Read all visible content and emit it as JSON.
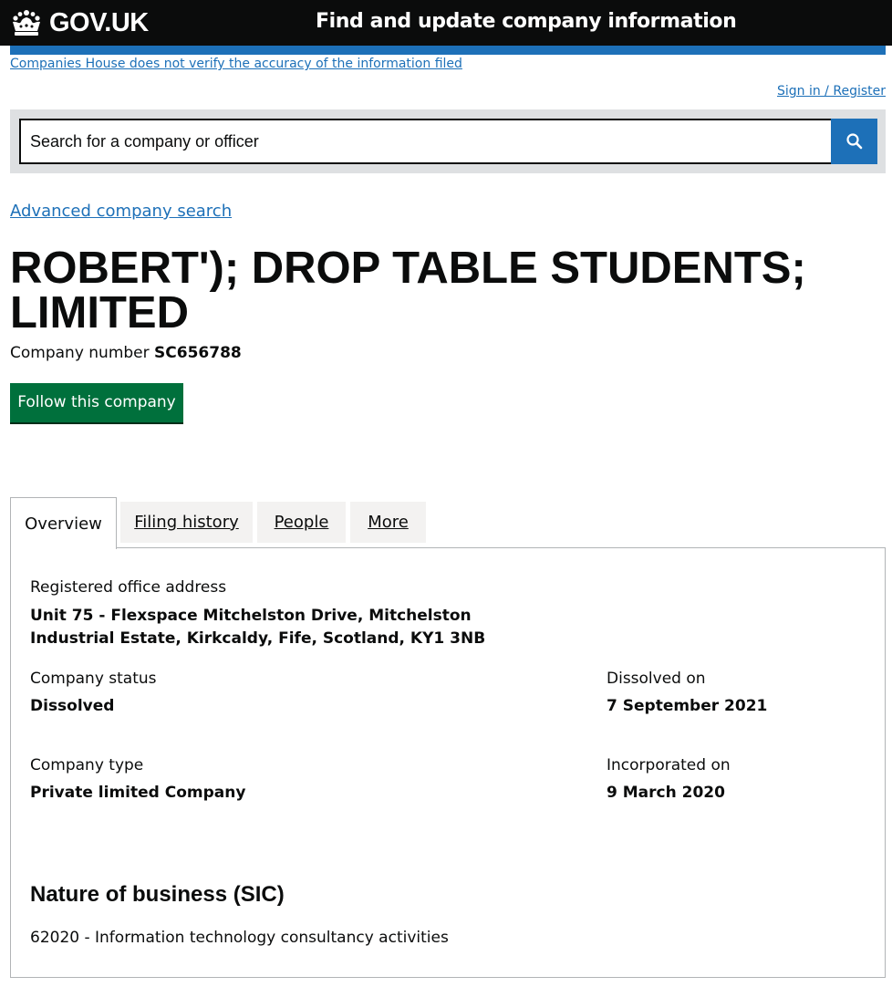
{
  "header": {
    "logo_text": "GOV.UK",
    "service_name": "Find and update company information"
  },
  "disclaimer": "Companies House does not verify the accuracy of the information filed",
  "sign_in": "Sign in / Register",
  "search": {
    "placeholder": "Search for a company or officer",
    "button_icon": "search-icon"
  },
  "advanced_search": "Advanced company search",
  "company": {
    "name": "ROBERT'); DROP TABLE STUDENTS; LIMITED",
    "number_label": "Company number",
    "number": "SC656788"
  },
  "follow_button": "Follow this company",
  "tabs": [
    {
      "label": "Overview",
      "active": true
    },
    {
      "label": "Filing history",
      "active": false
    },
    {
      "label": "People",
      "active": false
    },
    {
      "label": "More",
      "active": false
    }
  ],
  "overview": {
    "address_label": "Registered office address",
    "address": "Unit 75 - Flexspace Mitchelston Drive, Mitchelston Industrial Estate, Kirkcaldy, Fife, Scotland, KY1 3NB",
    "status_label": "Company status",
    "status": "Dissolved",
    "dissolved_label": "Dissolved on",
    "dissolved": "7 September 2021",
    "type_label": "Company type",
    "type": "Private limited Company",
    "incorporated_label": "Incorporated on",
    "incorporated": "9 March 2020",
    "sic_heading": "Nature of business (SIC)",
    "sic_items": [
      "62020 - Information technology consultancy activities"
    ]
  },
  "colors": {
    "header_bg": "#0b0c0c",
    "brand_blue": "#1d70b8",
    "button_green": "#00703c",
    "search_panel": "#dee0e2",
    "tab_inactive": "#f3f2f1"
  }
}
